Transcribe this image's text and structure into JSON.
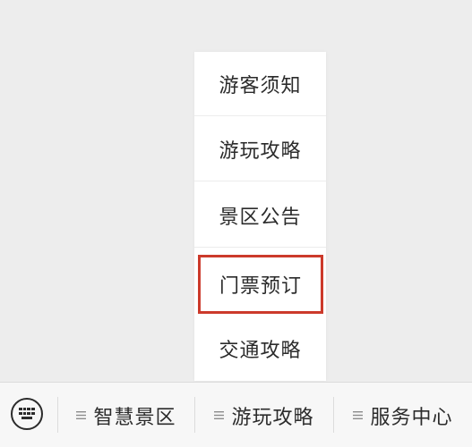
{
  "submenu": {
    "items": [
      {
        "label": "游客须知"
      },
      {
        "label": "游玩攻略"
      },
      {
        "label": "景区公告"
      },
      {
        "label": "门票预订"
      },
      {
        "label": "交通攻略"
      }
    ],
    "highlighted_label": "门票预订",
    "highlight_color": "#cc3a2b"
  },
  "bottom_bar": {
    "keyboard_icon": "keyboard-icon",
    "tabs": [
      {
        "label": "智慧景区",
        "icon": "menu-lines-icon"
      },
      {
        "label": "游玩攻略",
        "icon": "menu-lines-icon"
      },
      {
        "label": "服务中心",
        "icon": "menu-lines-icon"
      }
    ]
  }
}
